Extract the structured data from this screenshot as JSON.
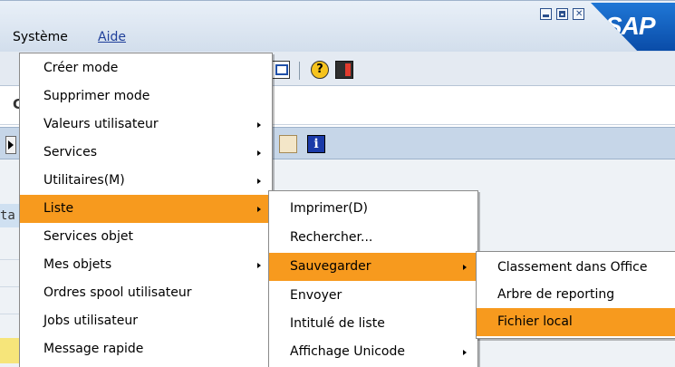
{
  "menubar": {
    "items": [
      "Système",
      "Aide"
    ]
  },
  "window": {
    "logo_text": "SAP"
  },
  "ghost": {
    "left_char": "C",
    "left_tab_text": "ta"
  },
  "menu_system": {
    "items": [
      {
        "label": "Créer mode",
        "submenu": false
      },
      {
        "label": "Supprimer mode",
        "submenu": false
      },
      {
        "label": "Valeurs utilisateur",
        "submenu": true
      },
      {
        "label": "Services",
        "submenu": true
      },
      {
        "label": "Utilitaires(M)",
        "submenu": true
      },
      {
        "label": "Liste",
        "submenu": true,
        "highlighted": true
      },
      {
        "label": "Services objet",
        "submenu": false
      },
      {
        "label": "Mes objets",
        "submenu": true
      },
      {
        "label": "Ordres spool utilisateur",
        "submenu": false
      },
      {
        "label": "Jobs utilisateur",
        "submenu": false
      },
      {
        "label": "Message rapide",
        "submenu": false
      }
    ]
  },
  "menu_liste": {
    "items": [
      {
        "label": "Imprimer(D)",
        "submenu": false
      },
      {
        "label": "Rechercher...",
        "submenu": false
      },
      {
        "label": "Sauvegarder",
        "submenu": true,
        "highlighted": true
      },
      {
        "label": "Envoyer",
        "submenu": false
      },
      {
        "label": "Intitulé de liste",
        "submenu": false
      },
      {
        "label": "Affichage Unicode",
        "submenu": true
      }
    ]
  },
  "menu_sauvegarder": {
    "items": [
      {
        "label": "Classement dans Office",
        "submenu": false
      },
      {
        "label": "Arbre de reporting",
        "submenu": false
      },
      {
        "label": "Fichier local",
        "submenu": false,
        "highlighted": true
      }
    ]
  },
  "icons": [
    "window-icon",
    "help-icon",
    "layout-icon",
    "grid-icon",
    "info-icon"
  ],
  "colors": {
    "highlight": "#f79a1e",
    "link": "#1f3f9a",
    "sap_blue": "#0a4ca8"
  }
}
